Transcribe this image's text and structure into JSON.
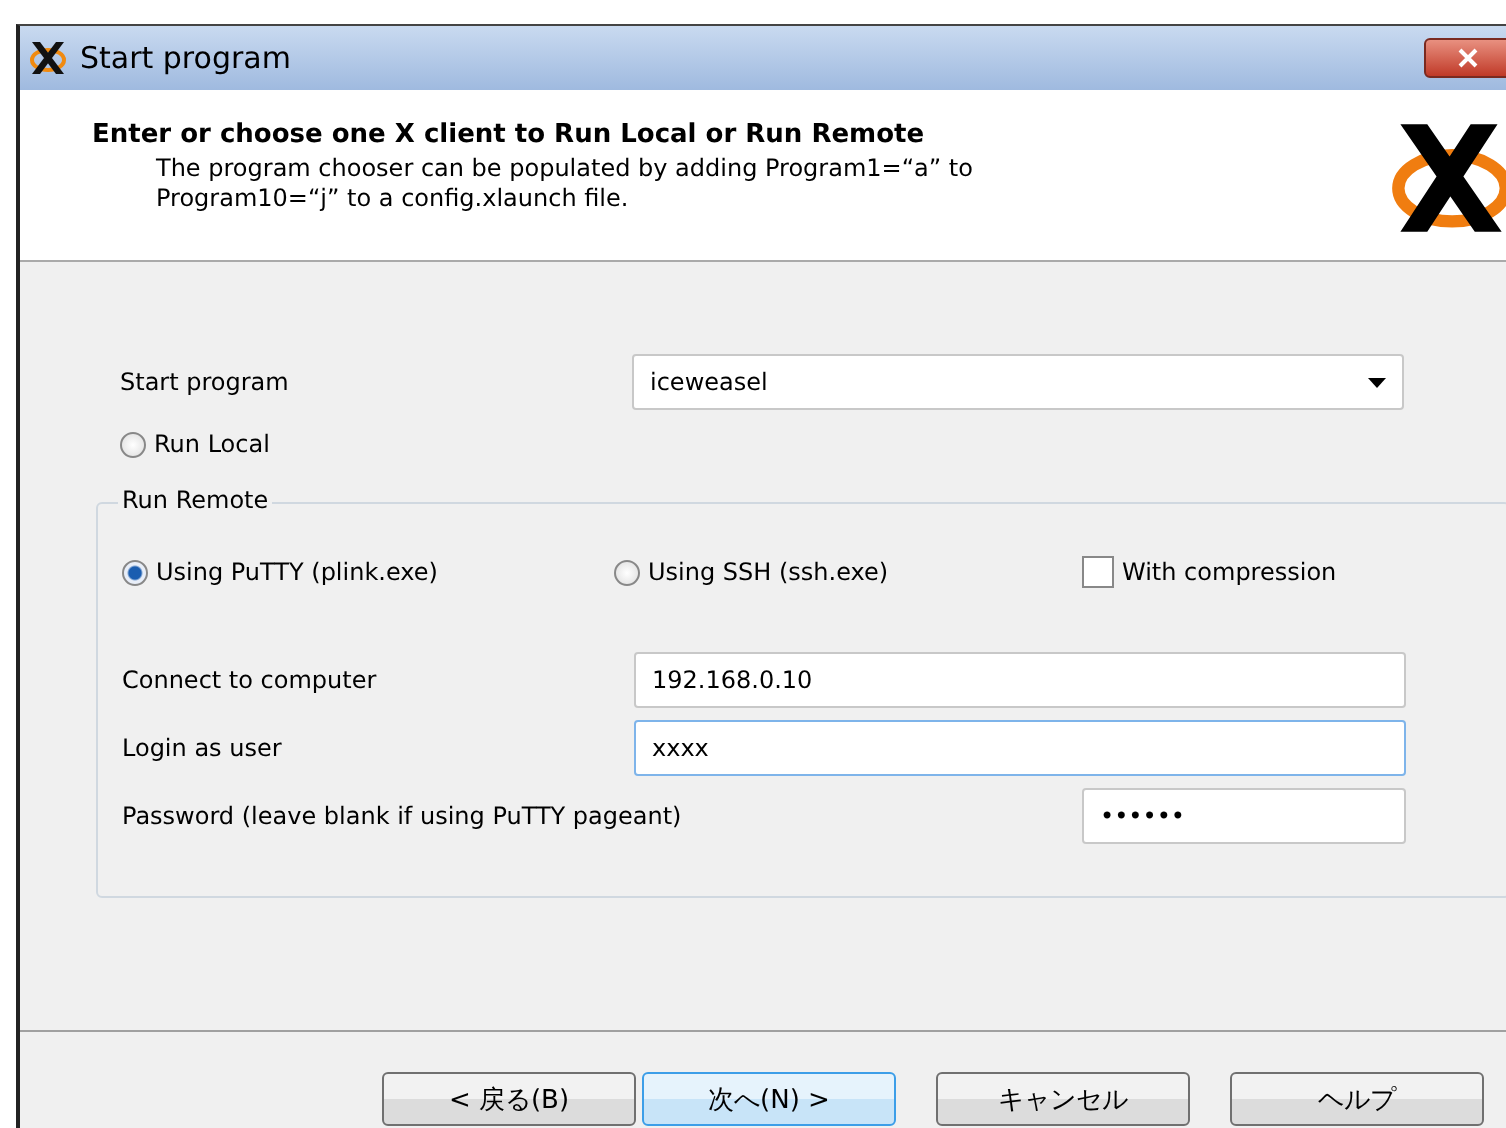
{
  "window": {
    "title": "Start program"
  },
  "header": {
    "heading": "Enter or choose one X client to Run Local or Run Remote",
    "description": "The program chooser can be populated by adding Program1=“a” to Program10=“j” to a config.xlaunch file."
  },
  "start_program": {
    "label": "Start program",
    "value": "iceweasel"
  },
  "run_local": {
    "label": "Run Local",
    "selected": false
  },
  "run_remote": {
    "label": "Run Remote",
    "methods": [
      {
        "label": "Using PuTTY (plink.exe)",
        "selected": true
      },
      {
        "label": "Using SSH (ssh.exe)",
        "selected": false
      }
    ],
    "compression": {
      "label": "With compression",
      "checked": false
    },
    "fields": [
      {
        "label": "Connect to computer",
        "value": "192.168.0.10",
        "focused": false,
        "kind": "wide"
      },
      {
        "label": "Login as user",
        "value": "xxxx",
        "focused": true,
        "kind": "wide"
      },
      {
        "label": "Password (leave blank if using PuTTY pageant)",
        "value": "••••••",
        "focused": false,
        "kind": "short"
      }
    ]
  },
  "buttons": [
    {
      "label": "< 戻る(B)",
      "default": false
    },
    {
      "label": "次へ(N) >",
      "default": true
    },
    {
      "label": "キャンセル",
      "default": false
    },
    {
      "label": "ヘルプ",
      "default": false
    }
  ]
}
